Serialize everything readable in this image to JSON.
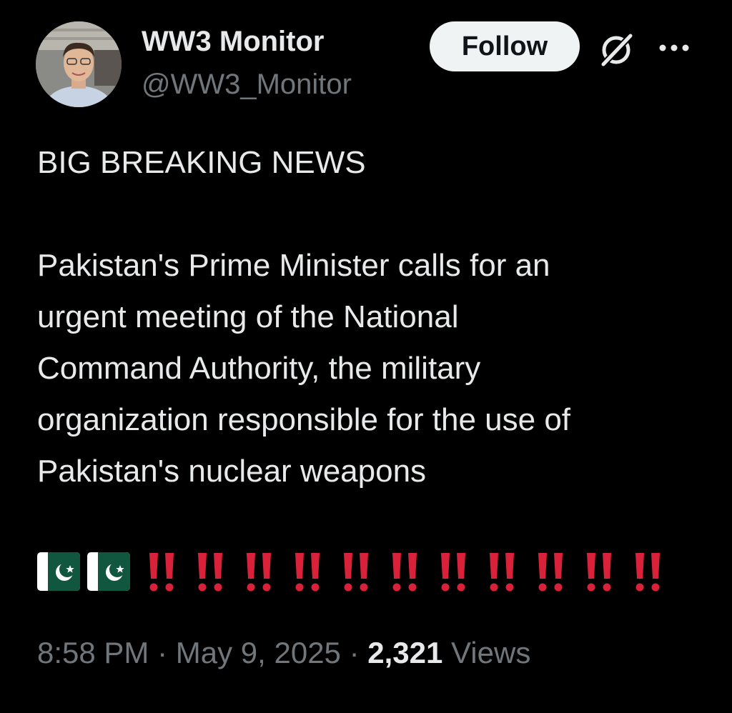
{
  "author": {
    "display_name": "WW3 Monitor",
    "handle": "@WW3_Monitor",
    "avatar_icon": "profile-photo"
  },
  "actions": {
    "follow_label": "Follow",
    "grok_icon": "grok-icon",
    "more_icon": "more-horizontal-icon"
  },
  "tweet": {
    "headline": "BIG BREAKING NEWS",
    "paragraph_lines": [
      "Pakistan's Prime Minister calls for an",
      "urgent meeting of the National",
      "Command Authority, the military",
      "organization responsible for the use of",
      "Pakistan's nuclear weapons"
    ],
    "emoji": {
      "flags": [
        "🇵🇰",
        "🇵🇰"
      ],
      "double_exclamations": [
        "‼️",
        "‼️",
        "‼️",
        "‼️",
        "‼️",
        "‼️",
        "‼️",
        "‼️",
        "‼️",
        "‼️",
        "‼️"
      ]
    }
  },
  "meta": {
    "time": "8:58 PM",
    "separator": "·",
    "date": "May 9, 2025",
    "views_count": "2,321",
    "views_label": "Views"
  },
  "colors": {
    "background": "#000000",
    "primary_text": "#e7e9ea",
    "secondary_text": "#71767b",
    "follow_bg": "#eff3f4",
    "exclamation_red": "#d9213a",
    "flag_green": "#115740"
  }
}
